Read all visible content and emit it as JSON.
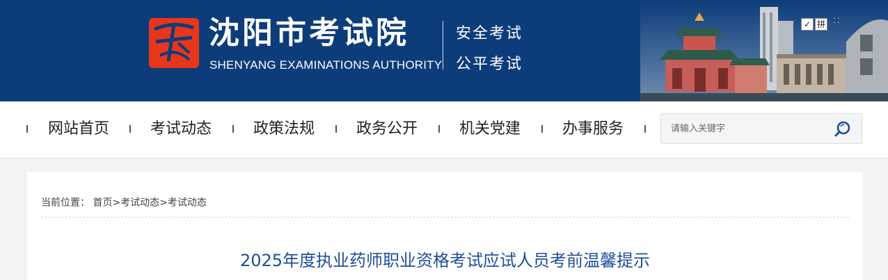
{
  "header": {
    "site_name": "沈阳市考试院",
    "site_name_en": "SHENYANG EXAMINATIONS AUTHORITY",
    "slogan_1": "安全考试",
    "slogan_2": "公平考试",
    "logo_text": "考",
    "util_1": "✓",
    "util_2": "拼",
    "util_3": "⸬"
  },
  "nav": {
    "items": [
      {
        "label": "网站首页"
      },
      {
        "label": "考试动态"
      },
      {
        "label": "政策法规"
      },
      {
        "label": "政务公开"
      },
      {
        "label": "机关党建"
      },
      {
        "label": "办事服务"
      }
    ],
    "search": {
      "placeholder": "请输入关键字"
    }
  },
  "breadcrumb": {
    "prefix": "当前位置：",
    "items": [
      "首页",
      "考试动态",
      "考试动态"
    ],
    "separator": ">"
  },
  "article": {
    "title": "2025年度执业药师职业资格考试应试人员考前温馨提示"
  },
  "colors": {
    "header_bg": "#0d3c7a",
    "seal_red": "#e8361b",
    "title_blue": "#1d4e9a"
  }
}
